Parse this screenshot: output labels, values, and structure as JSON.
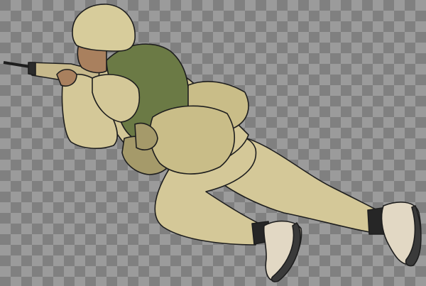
{
  "illustration": {
    "subject": "soldier",
    "parts": [
      "helmet",
      "rifle",
      "vest",
      "pouches",
      "arm",
      "legs",
      "boots"
    ],
    "colors": {
      "uniform": "#d4c898",
      "helmet": "#d7cc9b",
      "vest": "#6b7a45",
      "pouch": "#c9bd88",
      "pouch_dark": "#a59a6a",
      "boot_upper": "#e2d8c4",
      "boot_sole": "#3a3a3a",
      "skin": "#a9805e",
      "rifle": "#c7b98c",
      "checker_light": "#9b9b9b",
      "checker_dark": "#808080"
    }
  }
}
